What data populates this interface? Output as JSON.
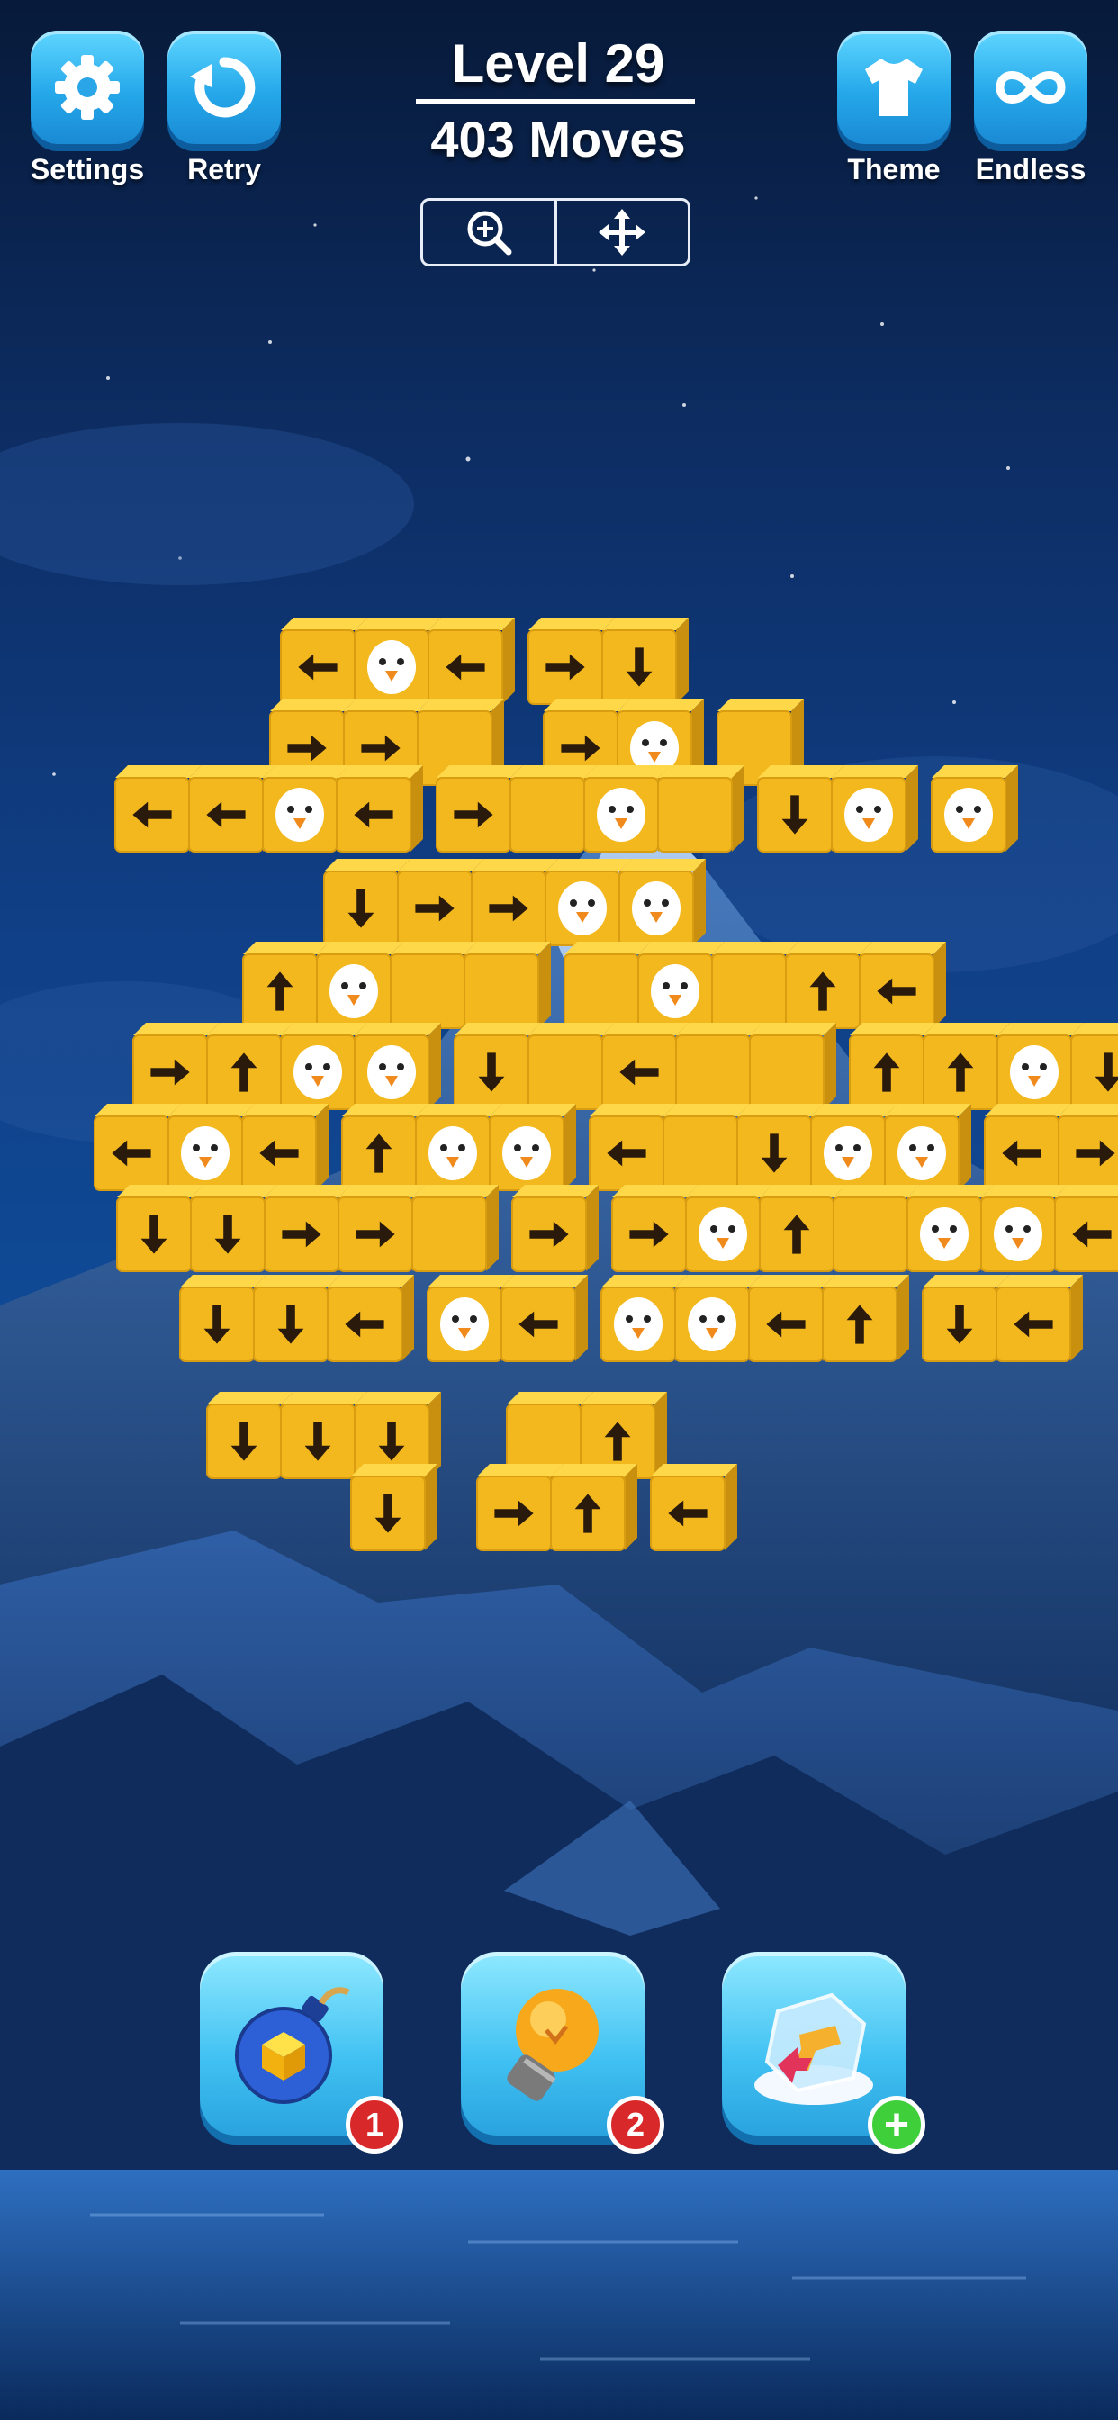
{
  "header": {
    "settings_label": "Settings",
    "retry_label": "Retry",
    "theme_label": "Theme",
    "endless_label": "Endless",
    "level_text": "Level 29",
    "moves_text": "403 Moves"
  },
  "view_controls": {
    "zoom_icon": "zoom-in-icon",
    "move_icon": "move-arrows-icon"
  },
  "boosters": [
    {
      "name": "bomb",
      "icon": "bomb-icon",
      "badge": "1"
    },
    {
      "name": "hint",
      "icon": "lightbulb-icon",
      "badge": "2"
    },
    {
      "name": "freeze",
      "icon": "ice-cube-icon",
      "badge": "+"
    }
  ],
  "puzzle": {
    "block_color": "#f2b81e",
    "face_types": [
      "arrow-up",
      "arrow-down",
      "arrow-left",
      "arrow-right",
      "bird-face"
    ]
  }
}
